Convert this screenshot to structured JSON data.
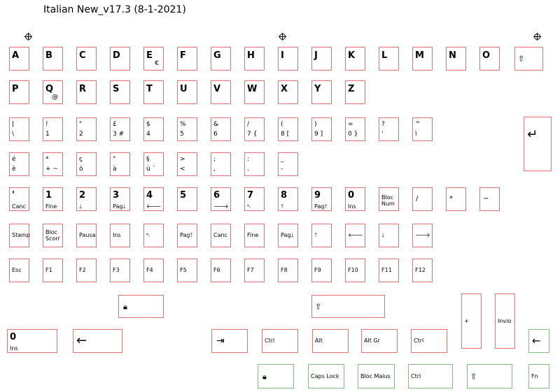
{
  "title": "Italian New_v17.3 (8-1-2021)",
  "icons": {
    "shift": "⇧",
    "lock": "🔒︎",
    "enter": "↵",
    "backspace": "←",
    "tab": "⇥"
  },
  "letters": [
    "A",
    "B",
    "C",
    "D",
    "E",
    "F",
    "G",
    "H",
    "I",
    "J",
    "K",
    "L",
    "M",
    "N",
    "O",
    "P",
    "Q",
    "R",
    "S",
    "T",
    "U",
    "V",
    "W",
    "X",
    "Y",
    "Z"
  ],
  "alt_glyphs": {
    "euro": "€",
    "at": "@"
  },
  "number_row": [
    {
      "top": "|",
      "bot": "\\"
    },
    {
      "top": "!",
      "bot": "1"
    },
    {
      "top": "\"",
      "bot": "2"
    },
    {
      "top": "£",
      "bot": "3  #"
    },
    {
      "top": "$",
      "bot": "4"
    },
    {
      "top": "%",
      "bot": "5"
    },
    {
      "top": "&",
      "bot": "6"
    },
    {
      "top": "/",
      "bot": "7  {"
    },
    {
      "top": "(",
      "bot": "8  ["
    },
    {
      "top": ")",
      "bot": "9  ]"
    },
    {
      "top": "=",
      "bot": "0  }"
    },
    {
      "top": "?",
      "bot": "'"
    },
    {
      "top": "^",
      "bot": "ì"
    }
  ],
  "symbol_row": [
    {
      "top": "é",
      "bot": "è"
    },
    {
      "top": "*",
      "bot": "+  ~"
    },
    {
      "top": "ç",
      "bot": "ò"
    },
    {
      "top": "°",
      "bot": "à"
    },
    {
      "top": "§",
      "bot": "ù  `"
    },
    {
      "top": ">",
      "bot": "<"
    },
    {
      "top": ";",
      "bot": ","
    },
    {
      "top": ":",
      "bot": "."
    },
    {
      "top": "_",
      "bot": "-"
    }
  ],
  "numpad_row": [
    {
      "big": "'",
      "small": "Canc"
    },
    {
      "big": "1",
      "small": "Fine"
    },
    {
      "big": "2",
      "small": "🡓"
    },
    {
      "big": "3",
      "small": "Pag🡓"
    },
    {
      "big": "4",
      "small": "🡐"
    },
    {
      "big": "5",
      "small": ""
    },
    {
      "big": "6",
      "small": "🡒"
    },
    {
      "big": "7",
      "small": "🡔"
    },
    {
      "big": "8",
      "small": "🡑"
    },
    {
      "big": "9",
      "small": "Pag🡑"
    },
    {
      "big": "0",
      "small": "Ins"
    }
  ],
  "bloc_num": [
    "Bloc",
    "Num"
  ],
  "numpad_ops": [
    "/",
    "*",
    "−"
  ],
  "nav_row": [
    [
      "Stamp"
    ],
    [
      "Bloc",
      "Scorr"
    ],
    [
      "Pausa"
    ],
    [
      "Ins"
    ],
    [
      "🡔"
    ],
    [
      "Pag🡑"
    ],
    [
      "Canc"
    ],
    [
      "Fine"
    ],
    [
      "Pag🡓"
    ],
    [
      "🡑"
    ],
    [
      "🡐"
    ],
    [
      "🡓"
    ],
    [
      "🡒"
    ]
  ],
  "fn_row": [
    "Esc",
    "F1",
    "F2",
    "F3",
    "F4",
    "F5",
    "F6",
    "F7",
    "F8",
    "F9",
    "F10",
    "F11",
    "F12"
  ],
  "numpad_plus": "+",
  "invio": "Invio",
  "zero_ins": {
    "big": "0",
    "small": "Ins"
  },
  "mods": {
    "ctrl": "Ctrl",
    "alt": "Alt",
    "altgr": "Alt Gr",
    "caps_lock": "Caps Lock",
    "bloc_maius": "Bloc Maius",
    "fn": "Fn"
  }
}
